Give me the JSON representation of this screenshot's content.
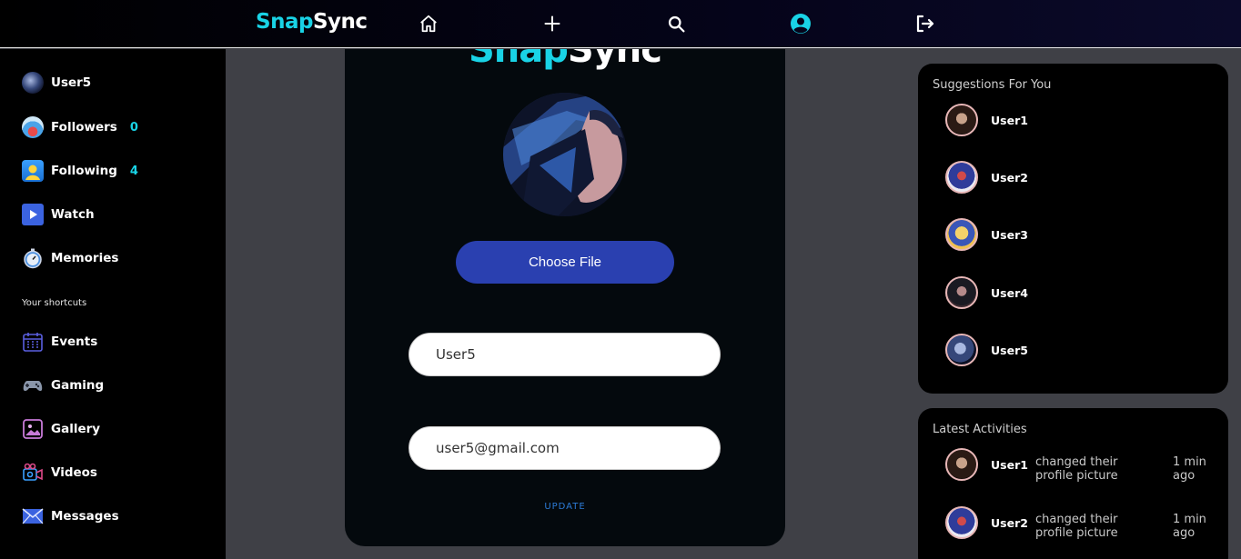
{
  "brand": {
    "part1": "Snap",
    "part2": "Sync"
  },
  "nav": {
    "icons": [
      "home-icon",
      "add-icon",
      "search-icon",
      "profile-icon",
      "logout-icon"
    ],
    "accent": "#19d3e6"
  },
  "sidebar": {
    "profile": {
      "label": "User5"
    },
    "items": [
      {
        "label": "Followers",
        "count": "0"
      },
      {
        "label": "Following",
        "count": "4"
      },
      {
        "label": "Watch"
      },
      {
        "label": "Memories"
      }
    ],
    "shortcuts_title": "Your shortcuts",
    "shortcuts": [
      {
        "label": "Events"
      },
      {
        "label": "Gaming"
      },
      {
        "label": "Gallery"
      },
      {
        "label": "Videos"
      },
      {
        "label": "Messages"
      }
    ]
  },
  "edit_profile": {
    "title_part1": "Snap",
    "title_part2": "Sync",
    "choose_file_label": "Choose File",
    "username_value": "User5",
    "email_value": "user5@gmail.com",
    "update_label": "UPDATE"
  },
  "suggestions": {
    "title": "Suggestions For You",
    "users": [
      "User1",
      "User2",
      "User3",
      "User4",
      "User5"
    ]
  },
  "activities": {
    "title": "Latest Activities",
    "items": [
      {
        "user": "User1",
        "text": "changed their profile picture",
        "time": "1 min ago"
      },
      {
        "user": "User2",
        "text": "changed their profile picture",
        "time": "1 min ago"
      }
    ]
  }
}
